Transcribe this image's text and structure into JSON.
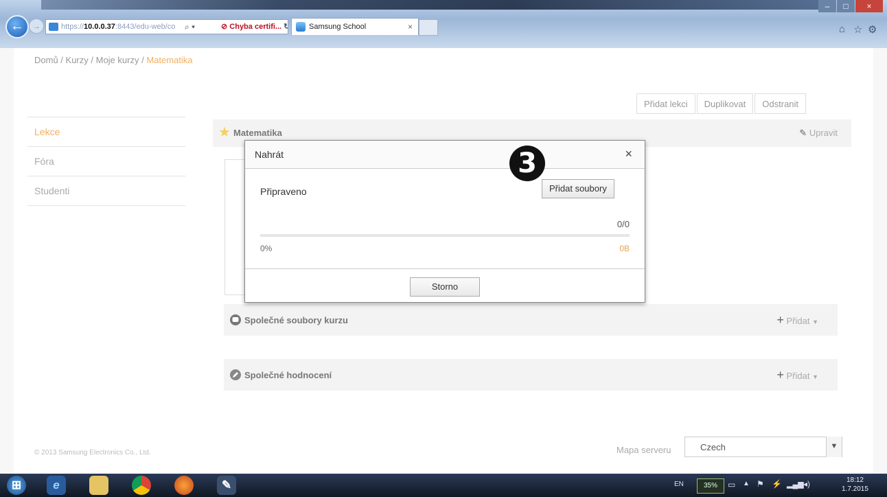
{
  "browser": {
    "url_scheme": "https://",
    "url_host": "10.0.0.37",
    "url_rest": ":8443/edu-web/co",
    "cert_error": "Chyba certifi...",
    "tab_title": "Samsung School"
  },
  "breadcrumb": {
    "items": [
      "Domů",
      "Kurzy",
      "Moje kurzy"
    ],
    "separator": " / ",
    "current": "Matematika"
  },
  "actions": {
    "add_lesson": "Přidat lekci",
    "duplicate": "Duplikovat",
    "delete": "Odstranit"
  },
  "sidebar": {
    "items": [
      {
        "label": "Lekce",
        "active": true
      },
      {
        "label": "Fóra"
      },
      {
        "label": "Studenti"
      }
    ]
  },
  "lesson": {
    "title": "Matematika",
    "edit_label": "Upravit"
  },
  "sections": {
    "course_files": {
      "title": "Společné soubory kurzu",
      "add_label": "Přidat"
    },
    "evaluation": {
      "title": "Společné hodnocení",
      "add_label": "Přidat"
    }
  },
  "upload_dialog": {
    "title": "Nahrát",
    "status": "Připraveno",
    "add_files_label": "Přidat soubory",
    "file_count": "0/0",
    "progress_percent": "0%",
    "progress_value": 0,
    "size": "0B",
    "cancel_label": "Storno"
  },
  "step_badge": "3",
  "footer": {
    "copyright": "© 2013 Samsung Electronics Co., Ltd.",
    "sitemap": "Mapa serveru",
    "language": "Czech"
  },
  "taskbar": {
    "lang": "EN",
    "battery": "35%",
    "time": "18:12",
    "date": "1.7.2015"
  },
  "colors": {
    "accent": "#f0b060",
    "progress": "#f0a040"
  }
}
